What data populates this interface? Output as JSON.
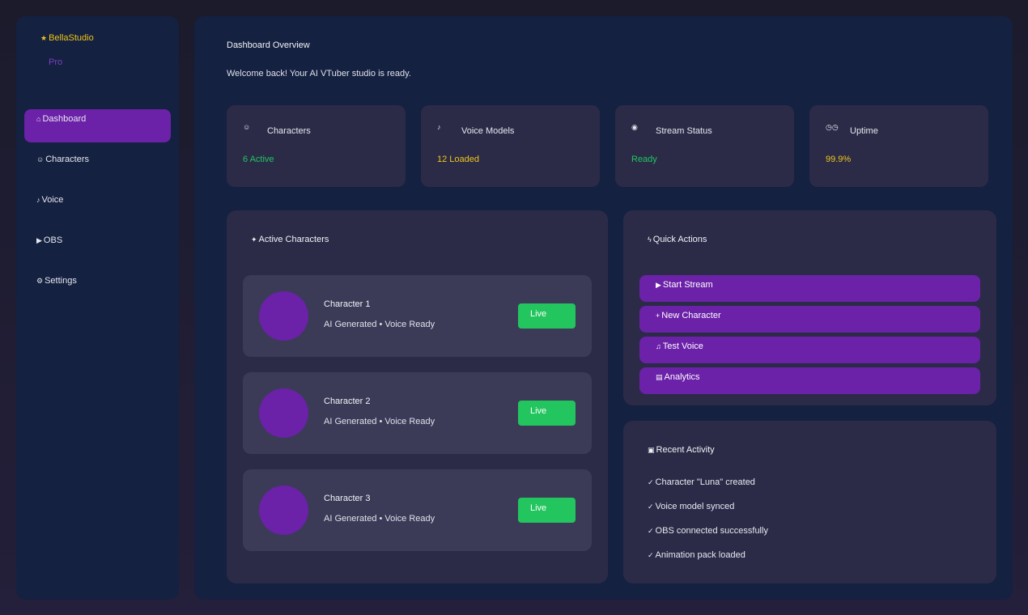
{
  "sidebar": {
    "brand": "BellaStudio",
    "brand_icon": "star-icon",
    "plan": "Pro",
    "items": [
      {
        "label": "Dashboard",
        "icon": "home-icon"
      },
      {
        "label": "Characters",
        "icon": "user-icon"
      },
      {
        "label": "Voice",
        "icon": "microphone-icon"
      },
      {
        "label": "OBS",
        "icon": "video-icon"
      },
      {
        "label": "Settings",
        "icon": "gear-icon"
      }
    ]
  },
  "header": {
    "title": "Dashboard Overview",
    "subtitle": "Welcome back! Your AI VTuber studio is ready."
  },
  "stats": [
    {
      "label": "Characters",
      "value": "6 Active",
      "color": "#22c55e",
      "icon": "users-icon"
    },
    {
      "label": "Voice Models",
      "value": "12 Loaded",
      "color": "#f0c419",
      "icon": "microphone-icon"
    },
    {
      "label": "Stream Status",
      "value": "Ready",
      "color": "#22c55e",
      "icon": "broadcast-icon"
    },
    {
      "label": "Uptime",
      "value": "99.9%",
      "color": "#f0c419",
      "icon": "clock-icon"
    }
  ],
  "characters_panel": {
    "title": "Active Characters",
    "icon": "sparkle-icon",
    "items": [
      {
        "name": "Character 1",
        "meta": "AI Generated • Voice Ready",
        "status": "Live"
      },
      {
        "name": "Character 2",
        "meta": "AI Generated • Voice Ready",
        "status": "Live"
      },
      {
        "name": "Character 3",
        "meta": "AI Generated • Voice Ready",
        "status": "Live"
      }
    ]
  },
  "quick_actions": {
    "title": "Quick Actions",
    "icon": "lightning-icon",
    "items": [
      {
        "label": "Start Stream",
        "icon": "play-icon"
      },
      {
        "label": "New Character",
        "icon": "plus-icon"
      },
      {
        "label": "Test Voice",
        "icon": "speaker-icon"
      },
      {
        "label": "Analytics",
        "icon": "chart-icon"
      }
    ]
  },
  "recent_activity": {
    "title": "Recent Activity",
    "icon": "clipboard-icon",
    "items": [
      "Character \"Luna\" created",
      "Voice model synced",
      "OBS connected successfully",
      "Animation pack loaded"
    ]
  },
  "colors": {
    "accent": "#6b21a8",
    "success": "#22c55e",
    "warning": "#f0c419",
    "panel": "#2b2b48",
    "background": "#142140"
  }
}
